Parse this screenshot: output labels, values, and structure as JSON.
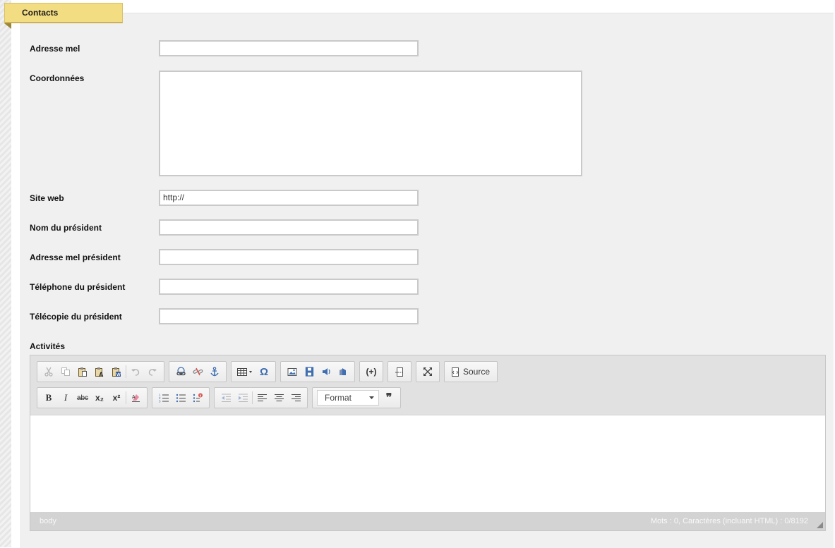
{
  "section": {
    "title": "Contacts"
  },
  "fields": {
    "email_label": "Adresse mel",
    "email_value": "",
    "coords_label": "Coordonnées",
    "coords_value": "",
    "website_label": "Site web",
    "website_value": "http://",
    "president_name_label": "Nom du président",
    "president_name_value": "",
    "president_email_label": "Adresse mel président",
    "president_email_value": "",
    "president_phone_label": "Téléphone du président",
    "president_phone_value": "",
    "president_fax_label": "Télécopie du président",
    "president_fax_value": "",
    "activities_label": "Activités"
  },
  "editor": {
    "source_label": "Source",
    "format_label": "Format",
    "bold_label": "B",
    "italic_label": "I",
    "strike_label": "abc",
    "sub_label": "x₂",
    "sup_label": "x²",
    "special_char_label": "Ω",
    "blockquote_label": "❞",
    "insert_code_label": "(+)",
    "statusbar_path": "body",
    "statusbar_count": "Mots : 0, Caractères (incluant HTML) : 0/8192"
  },
  "icons": {
    "toolbar_row1": [
      "cut-icon",
      "copy-icon",
      "paste-icon",
      "paste-text-icon",
      "paste-word-icon",
      "undo-icon",
      "redo-icon",
      "link-icon",
      "unlink-icon",
      "anchor-icon",
      "table-icon",
      "special-char-icon",
      "image-icon",
      "video-icon",
      "audio-icon",
      "flash-icon",
      "insert-code-icon",
      "page-break-icon",
      "maximize-icon",
      "source-icon"
    ],
    "toolbar_row2": [
      "bold-icon",
      "italic-icon",
      "strikethrough-icon",
      "subscript-icon",
      "superscript-icon",
      "remove-format-icon",
      "numbered-list-icon",
      "bulleted-list-icon",
      "checklist-icon",
      "outdent-icon",
      "indent-icon",
      "align-left-icon",
      "align-center-icon",
      "align-right-icon",
      "format-dropdown-icon",
      "blockquote-icon"
    ]
  },
  "colors": {
    "tab_background": "#f3dd83",
    "panel_background": "#f0f0f0",
    "toolbar_icon_blue": "#3f6fb0",
    "disabled_icon": "#b6b6b6"
  }
}
